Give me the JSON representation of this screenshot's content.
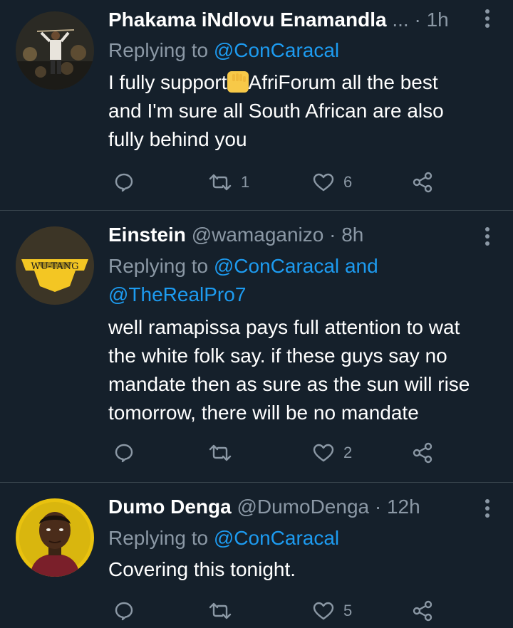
{
  "colors": {
    "background": "#15202b",
    "text": "#ffffff",
    "secondary": "#8b98a5",
    "link": "#1d9bf0",
    "divider": "#38444d"
  },
  "tweets": [
    {
      "name": "Phakama iNdlovu Enamandla",
      "handle": "...",
      "time": "· 1h",
      "replying_label": "Replying to",
      "reply_mentions": [
        "@ConCaracal"
      ],
      "body_lines": [
        "I fully support",
        "AfriForum all the best",
        "and I'm sure all South African are also",
        "fully behind you"
      ],
      "emoji": "raised-fist-emoji",
      "retweets": "1",
      "likes": "6"
    },
    {
      "name": "Einstein",
      "handle": "@wamaganizo",
      "time": "· 8h",
      "replying_label": "Replying to",
      "reply_mentions": [
        "@ConCaracal",
        "and",
        "@TheRealPro7"
      ],
      "body_lines": [
        "well ramapissa pays full attention to wat",
        "the white folk say. if these guys say no",
        "mandate then as sure as the sun will rise",
        "tomorrow, there will be no mandate"
      ],
      "retweets": "",
      "likes": "2",
      "avatar_text": "WU-TANG"
    },
    {
      "name": "Dumo Denga",
      "handle": "@DumoDenga",
      "time": "· 12h",
      "replying_label": "Replying to",
      "reply_mentions": [
        "@ConCaracal"
      ],
      "body_lines": [
        "Covering this tonight."
      ],
      "retweets": "",
      "likes": "5"
    }
  ]
}
